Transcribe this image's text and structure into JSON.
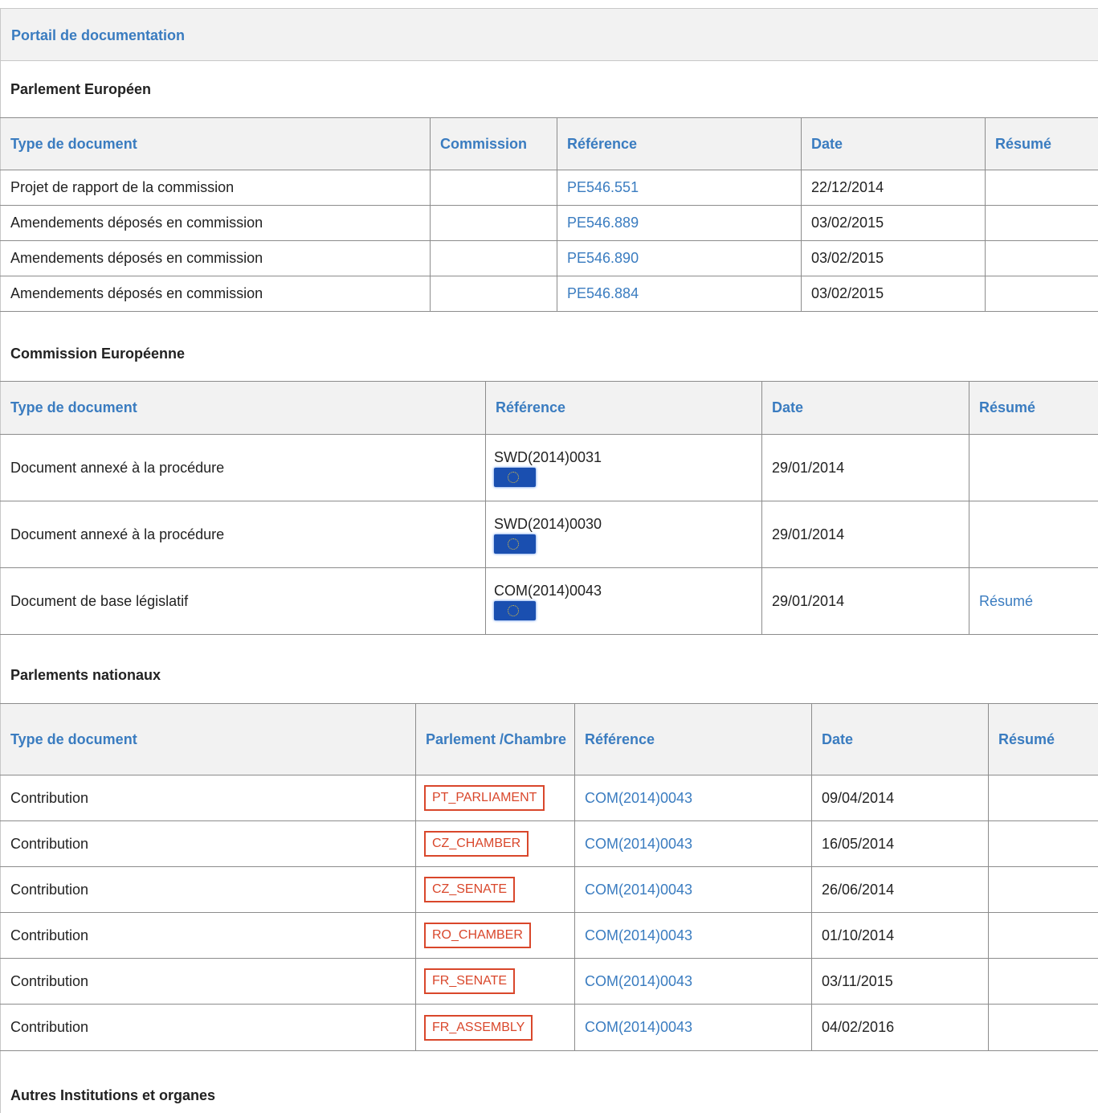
{
  "portal_title": "Portail de documentation",
  "ep": {
    "title": "Parlement Européen",
    "headers": [
      "Type de document",
      "Commission",
      "Référence",
      "Date",
      "Résumé"
    ],
    "rows": [
      {
        "type": "Projet de rapport de la commission",
        "committee": "",
        "reference": "PE546.551",
        "date": "22/12/2014",
        "summary": ""
      },
      {
        "type": "Amendements déposés en commission",
        "committee": "",
        "reference": "PE546.889",
        "date": "03/02/2015",
        "summary": ""
      },
      {
        "type": "Amendements déposés en commission",
        "committee": "",
        "reference": "PE546.890",
        "date": "03/02/2015",
        "summary": ""
      },
      {
        "type": "Amendements déposés en commission",
        "committee": "",
        "reference": "PE546.884",
        "date": "03/02/2015",
        "summary": ""
      }
    ]
  },
  "ec": {
    "title": "Commission Européenne",
    "headers": [
      "Type de document",
      "Référence",
      "Date",
      "Résumé"
    ],
    "rows": [
      {
        "type": "Document annexé à la procédure",
        "reference": "SWD(2014)0031",
        "date": "29/01/2014",
        "summary": ""
      },
      {
        "type": "Document annexé à la procédure",
        "reference": "SWD(2014)0030",
        "date": "29/01/2014",
        "summary": ""
      },
      {
        "type": "Document de base législatif",
        "reference": "COM(2014)0043",
        "date": "29/01/2014",
        "summary": "Résumé"
      }
    ]
  },
  "np": {
    "title": "Parlements nationaux",
    "headers": [
      "Type de document",
      "Parlement /Chambre",
      "Référence",
      "Date",
      "Résumé"
    ],
    "rows": [
      {
        "type": "Contribution",
        "chamber": "PT_PARLIAMENT",
        "reference": "COM(2014)0043",
        "date": "09/04/2014",
        "summary": ""
      },
      {
        "type": "Contribution",
        "chamber": "CZ_CHAMBER",
        "reference": "COM(2014)0043",
        "date": "16/05/2014",
        "summary": ""
      },
      {
        "type": "Contribution",
        "chamber": "CZ_SENATE",
        "reference": "COM(2014)0043",
        "date": "26/06/2014",
        "summary": ""
      },
      {
        "type": "Contribution",
        "chamber": "RO_CHAMBER",
        "reference": "COM(2014)0043",
        "date": "01/10/2014",
        "summary": ""
      },
      {
        "type": "Contribution",
        "chamber": "FR_SENATE",
        "reference": "COM(2014)0043",
        "date": "03/11/2015",
        "summary": ""
      },
      {
        "type": "Contribution",
        "chamber": "FR_ASSEMBLY",
        "reference": "COM(2014)0043",
        "date": "04/02/2016",
        "summary": ""
      }
    ]
  },
  "other": {
    "title": "Autres Institutions et organes"
  },
  "colors": {
    "link": "#3a7cc0",
    "tag": "#d9472b",
    "header_bg": "#f2f2f2"
  },
  "icons": {
    "ec_flag": "eu-flag-icon"
  }
}
